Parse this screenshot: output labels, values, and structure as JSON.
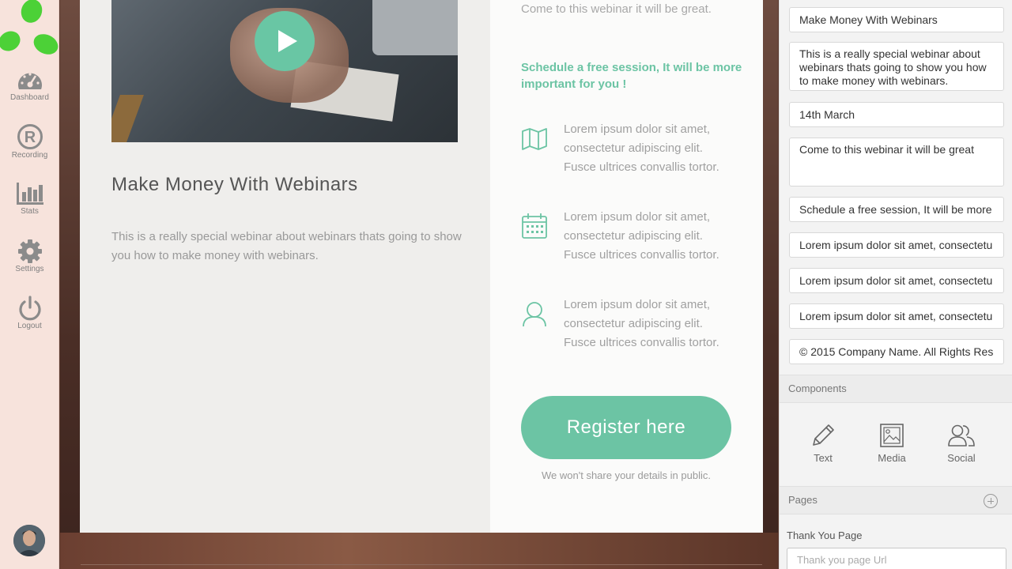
{
  "colors": {
    "accent": "#6cc4a4",
    "logo": "#4cd137",
    "sidebar_bg": "#f7e3dc"
  },
  "sidebar": {
    "logo_icon": "trefoil-logo",
    "items": [
      {
        "label": "Dashboard",
        "icon": "dashboard-gauge-icon"
      },
      {
        "label": "Recording",
        "icon": "registered-icon"
      },
      {
        "label": "Stats",
        "icon": "bar-chart-icon"
      },
      {
        "label": "Settings",
        "icon": "gear-icon"
      },
      {
        "label": "Logout",
        "icon": "power-icon"
      }
    ]
  },
  "page": {
    "title": "Make Money With Webinars",
    "description": "This is a really special webinar about webinars thats going to show you how to make money with webinars.",
    "top_text": "Come to this webinar it will be great.",
    "cta_text": "Schedule a free session, It will be more important for you !",
    "features": [
      {
        "icon": "map-icon",
        "text": "Lorem ipsum dolor sit amet, consectetur adipiscing elit. Fusce ultrices convallis tortor."
      },
      {
        "icon": "calendar-icon",
        "text": "Lorem ipsum dolor sit amet, consectetur adipiscing elit. Fusce ultrices convallis tortor."
      },
      {
        "icon": "user-icon",
        "text": "Lorem ipsum dolor sit amet, consectetur adipiscing elit. Fusce ultrices convallis tortor."
      }
    ],
    "register_label": "Register here",
    "privacy_note": "We won't share your details in public."
  },
  "editor": {
    "fields": [
      "Make Money With Webinars",
      "This is a really special webinar about webinars thats going to show you how to make money with webinars.",
      "14th March",
      "Come to this webinar it will be great",
      "Schedule a free session, It will be more",
      "Lorem ipsum dolor sit amet, consectetu",
      "Lorem ipsum dolor sit amet, consectetu",
      "Lorem ipsum dolor sit amet, consectetu",
      "© 2015 Company Name. All Rights Res"
    ],
    "components_header": "Components",
    "components": [
      {
        "label": "Text",
        "icon": "pencil-icon"
      },
      {
        "label": "Media",
        "icon": "image-icon"
      },
      {
        "label": "Social",
        "icon": "users-icon"
      }
    ],
    "pages_header": "Pages",
    "page_name": "Thank You Page",
    "page_url_placeholder": "Thank you page Url"
  }
}
